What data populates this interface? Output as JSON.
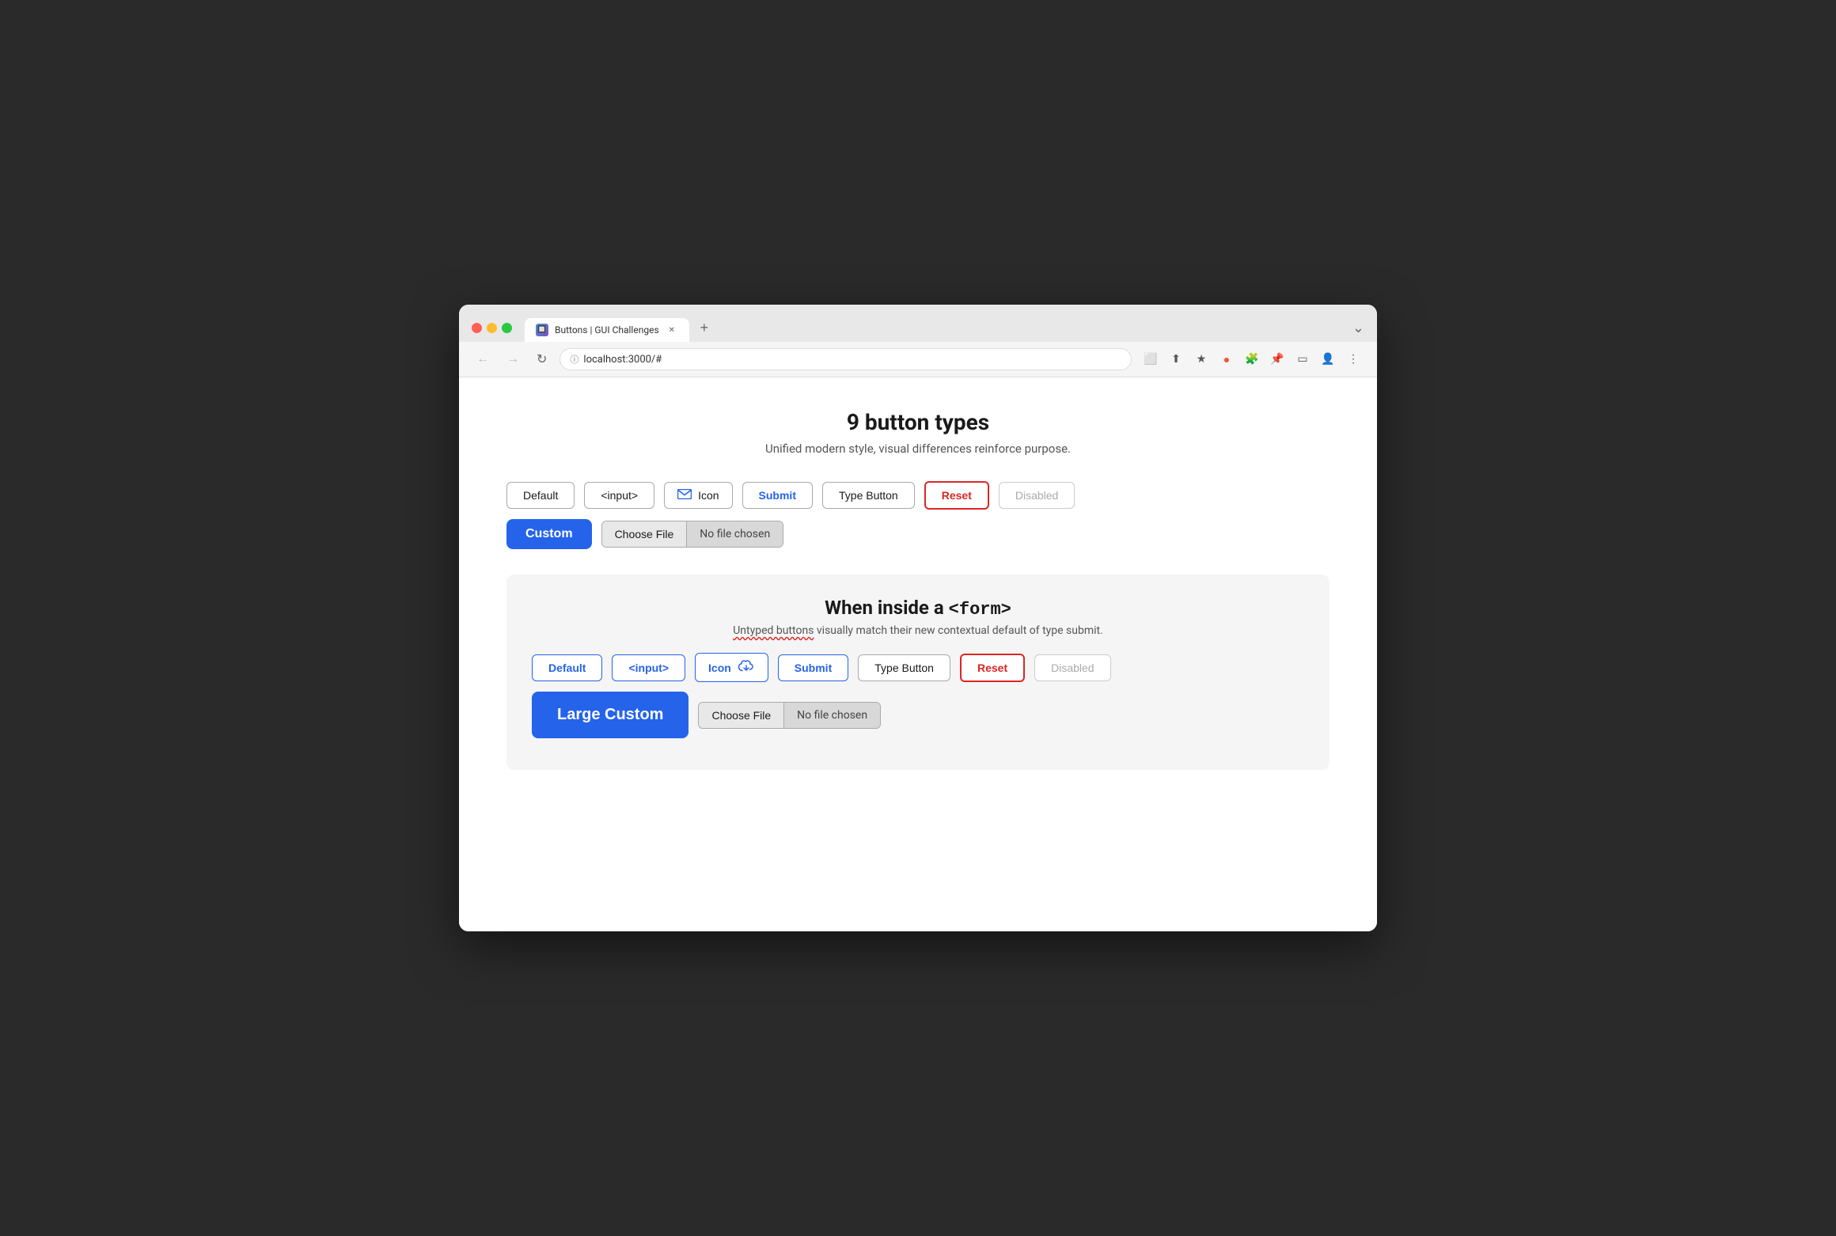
{
  "browser": {
    "tab_title": "Buttons | GUI Challenges",
    "tab_favicon": "🔲",
    "address": "localhost:3000/#",
    "new_tab_btn": "+",
    "chevron_down": "⌄"
  },
  "nav": {
    "back": "←",
    "forward": "→",
    "reload": "↻",
    "lock_icon": "ⓘ"
  },
  "page": {
    "main_title": "9 button types",
    "main_subtitle": "Unified modern style, visual differences reinforce purpose.",
    "buttons_row1": [
      {
        "label": "Default",
        "type": "default"
      },
      {
        "label": "<input>",
        "type": "default"
      },
      {
        "label": "Icon",
        "type": "icon"
      },
      {
        "label": "Submit",
        "type": "submit"
      },
      {
        "label": "Type Button",
        "type": "default"
      },
      {
        "label": "Reset",
        "type": "reset"
      },
      {
        "label": "Disabled",
        "type": "disabled"
      }
    ],
    "custom_btn_label": "Custom",
    "choose_file_label": "Choose File",
    "no_file_label": "No file chosen",
    "form_section": {
      "title_text": "When inside a ",
      "title_code": "<form>",
      "subtitle_normal": " visually match their new contextual default of type submit.",
      "subtitle_underline": "Untyped buttons",
      "buttons_row1": [
        {
          "label": "Default",
          "type": "submit-form"
        },
        {
          "label": "<input>",
          "type": "submit-form"
        },
        {
          "label": "Icon",
          "type": "icon-form"
        },
        {
          "label": "Submit",
          "type": "submit-form"
        },
        {
          "label": "Type Button",
          "type": "default"
        },
        {
          "label": "Reset",
          "type": "reset"
        },
        {
          "label": "Disabled",
          "type": "disabled"
        }
      ],
      "large_custom_label": "Large Custom",
      "choose_file_label": "Choose File",
      "no_file_label": "No file chosen"
    }
  }
}
